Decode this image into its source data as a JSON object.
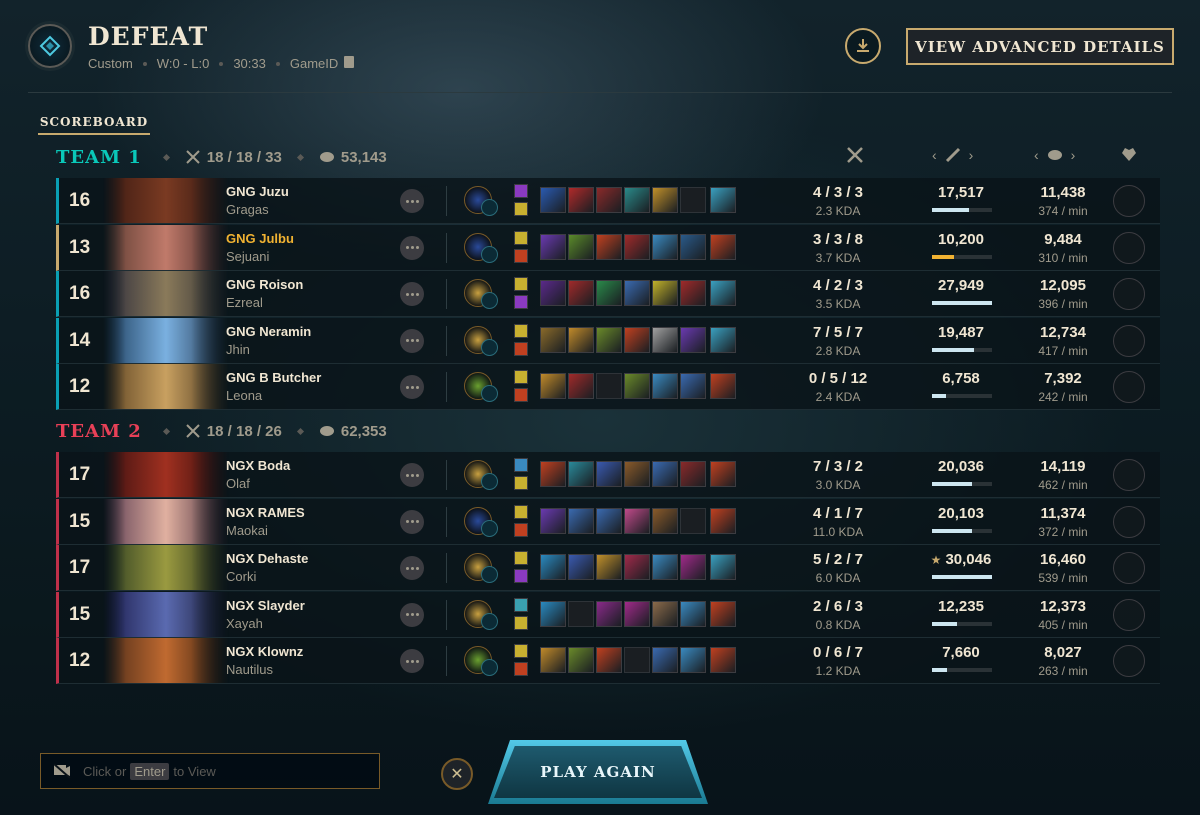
{
  "header": {
    "result": "DEFEAT",
    "mode": "Custom",
    "record": "W:0 - L:0",
    "duration": "30:33",
    "game_id_label": "GameID",
    "advanced_button": "VIEW ADVANCED DETAILS"
  },
  "tabs": {
    "scoreboard": "SCOREBOARD"
  },
  "team1": {
    "name": "TEAM 1",
    "kda": "18 / 18 / 33",
    "gold": "53,143",
    "color": "#0ac8b9",
    "players": [
      {
        "level": "16",
        "name": "GNG Juzu",
        "champion": "Gragas",
        "kda": "4 / 3 / 3",
        "kda_ratio": "2.3 KDA",
        "damage": "17,517",
        "damage_share": 0.62,
        "gold": "11,438",
        "gpm": "374 / min",
        "star": false
      },
      {
        "level": "13",
        "name": "GNG Julbu",
        "champion": "Sejuani",
        "kda": "3 / 3 / 8",
        "kda_ratio": "3.7 KDA",
        "damage": "10,200",
        "damage_share": 0.36,
        "gold": "9,484",
        "gpm": "310 / min",
        "star": false,
        "is_self": true
      },
      {
        "level": "16",
        "name": "GNG Roison",
        "champion": "Ezreal",
        "kda": "4 / 2 / 3",
        "kda_ratio": "3.5 KDA",
        "damage": "27,949",
        "damage_share": 1.0,
        "gold": "12,095",
        "gpm": "396 / min",
        "star": false
      },
      {
        "level": "14",
        "name": "GNG Neramin",
        "champion": "Jhin",
        "kda": "7 / 5 / 7",
        "kda_ratio": "2.8 KDA",
        "damage": "19,487",
        "damage_share": 0.7,
        "gold": "12,734",
        "gpm": "417 / min",
        "star": false
      },
      {
        "level": "12",
        "name": "GNG B Butcher",
        "champion": "Leona",
        "kda": "0 / 5 / 12",
        "kda_ratio": "2.4 KDA",
        "damage": "6,758",
        "damage_share": 0.24,
        "gold": "7,392",
        "gpm": "242 / min",
        "star": false
      }
    ]
  },
  "team2": {
    "name": "TEAM 2",
    "kda": "18 / 18 / 26",
    "gold": "62,353",
    "color": "#e84057",
    "players": [
      {
        "level": "17",
        "name": "NGX Boda",
        "champion": "Olaf",
        "kda": "7 / 3 / 2",
        "kda_ratio": "3.0 KDA",
        "damage": "20,036",
        "damage_share": 0.67,
        "gold": "14,119",
        "gpm": "462 / min",
        "star": false
      },
      {
        "level": "15",
        "name": "NGX RAMES",
        "champion": "Maokai",
        "kda": "4 / 1 / 7",
        "kda_ratio": "11.0 KDA",
        "damage": "20,103",
        "damage_share": 0.67,
        "gold": "11,374",
        "gpm": "372 / min",
        "star": false
      },
      {
        "level": "17",
        "name": "NGX Dehaste",
        "champion": "Corki",
        "kda": "5 / 2 / 7",
        "kda_ratio": "6.0 KDA",
        "damage": "30,046",
        "damage_share": 1.0,
        "gold": "16,460",
        "gpm": "539 / min",
        "star": true
      },
      {
        "level": "15",
        "name": "NGX Slayder",
        "champion": "Xayah",
        "kda": "2 / 6 / 3",
        "kda_ratio": "0.8 KDA",
        "damage": "12,235",
        "damage_share": 0.41,
        "gold": "12,373",
        "gpm": "405 / min",
        "star": false
      },
      {
        "level": "12",
        "name": "NGX Klownz",
        "champion": "Nautilus",
        "kda": "0 / 6 / 7",
        "kda_ratio": "1.2 KDA",
        "damage": "7,660",
        "damage_share": 0.25,
        "gold": "8,027",
        "gpm": "263 / min",
        "star": false
      }
    ]
  },
  "footer": {
    "chat_prefix": "Click or",
    "chat_key": "Enter",
    "chat_suffix": "to View",
    "play_again": "PLAY AGAIN"
  }
}
